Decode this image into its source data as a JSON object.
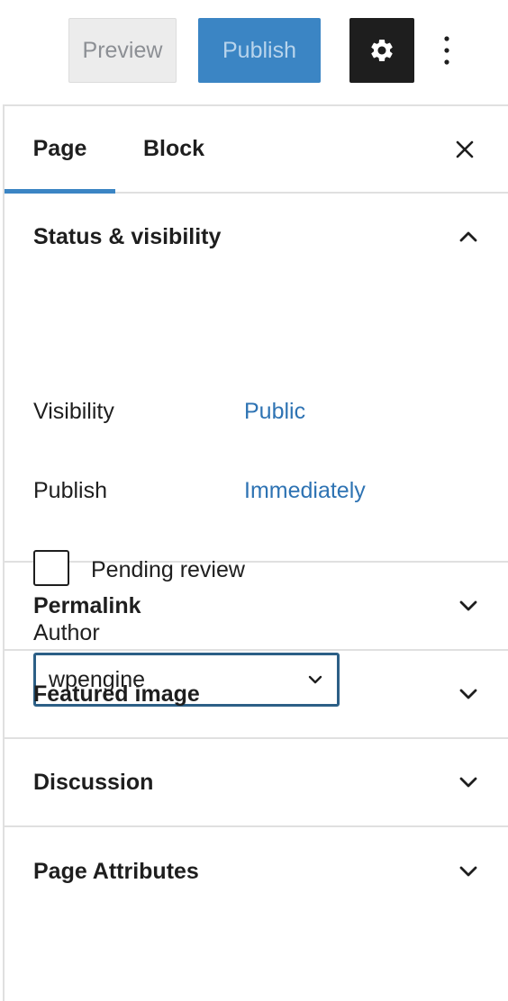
{
  "toolbar": {
    "preview_label": "Preview",
    "publish_label": "Publish",
    "settings_icon": "gear-icon",
    "more_icon": "vertical-ellipsis-icon"
  },
  "tabs": {
    "page": "Page",
    "block": "Block",
    "close_icon": "close-icon",
    "active": "Page"
  },
  "status": {
    "title": "Status & visibility",
    "expanded": true,
    "visibility_label": "Visibility",
    "visibility_value": "Public",
    "publish_label": "Publish",
    "publish_value": "Immediately",
    "pending_label": "Pending review",
    "pending_checked": false,
    "author_label": "Author",
    "author_value": "wpengine"
  },
  "sections": [
    {
      "title": "Permalink"
    },
    {
      "title": "Featured image"
    },
    {
      "title": "Discussion"
    },
    {
      "title": "Page Attributes"
    }
  ],
  "colors": {
    "accent": "#3b85c4",
    "link": "#2e73b3",
    "dark": "#1e1e1e"
  }
}
